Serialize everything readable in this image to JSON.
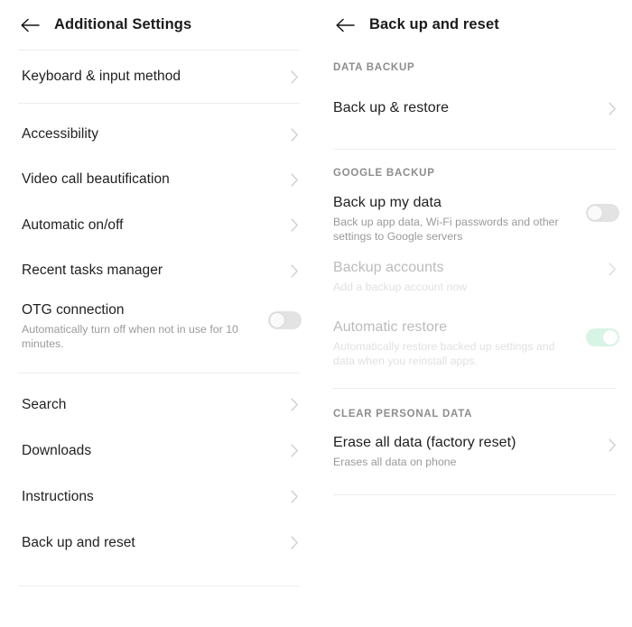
{
  "left_panel": {
    "header": {
      "back_icon": "back-arrow-icon",
      "title": "Additional Settings"
    },
    "items": [
      {
        "title": "Keyboard & input method",
        "control": "chevron"
      },
      {
        "title": "Accessibility",
        "control": "chevron"
      },
      {
        "title": "Video call beautification",
        "control": "chevron"
      },
      {
        "title": "Automatic on/off",
        "control": "chevron"
      },
      {
        "title": "Recent tasks manager",
        "control": "chevron"
      },
      {
        "title": "OTG connection",
        "subtitle": "Automatically turn off when not in use for 10 minutes.",
        "control": "toggle",
        "toggle_on": false
      },
      {
        "title": "Search",
        "control": "chevron"
      },
      {
        "title": "Downloads",
        "control": "chevron"
      },
      {
        "title": "Instructions",
        "control": "chevron"
      },
      {
        "title": "Back up and reset",
        "control": "chevron"
      }
    ]
  },
  "right_panel": {
    "header": {
      "back_icon": "back-arrow-icon",
      "title": "Back up and reset"
    },
    "sections": [
      {
        "label": "DATA BACKUP",
        "items": [
          {
            "title": "Back up & restore",
            "control": "chevron",
            "disabled": false
          }
        ]
      },
      {
        "label": "GOOGLE BACKUP",
        "items": [
          {
            "title": "Back up my data",
            "subtitle": "Back up app data, Wi-Fi passwords and other settings to Google servers",
            "control": "toggle",
            "toggle_on": false,
            "disabled": false
          },
          {
            "title": "Backup accounts",
            "subtitle": "Add a backup account now",
            "control": "chevron",
            "disabled": true
          },
          {
            "title": "Automatic restore",
            "subtitle": "Automatically restore backed up settings and data when you reinstall apps.",
            "control": "toggle",
            "toggle_on": true,
            "disabled": true
          }
        ]
      },
      {
        "label": "CLEAR PERSONAL DATA",
        "items": [
          {
            "title": "Erase all data (factory reset)",
            "subtitle": "Erases all data on phone",
            "control": "chevron",
            "disabled": false
          }
        ]
      }
    ]
  },
  "colors": {
    "background": "#ffffff",
    "primary_text": "#1f1f1f",
    "secondary_text": "#9a9a9a",
    "section_label": "#8d8d8d",
    "divider": "#ededed",
    "toggle_off": "#e3e3e3",
    "toggle_on": "#7fdcab",
    "chevron": "#d2d2d2"
  }
}
